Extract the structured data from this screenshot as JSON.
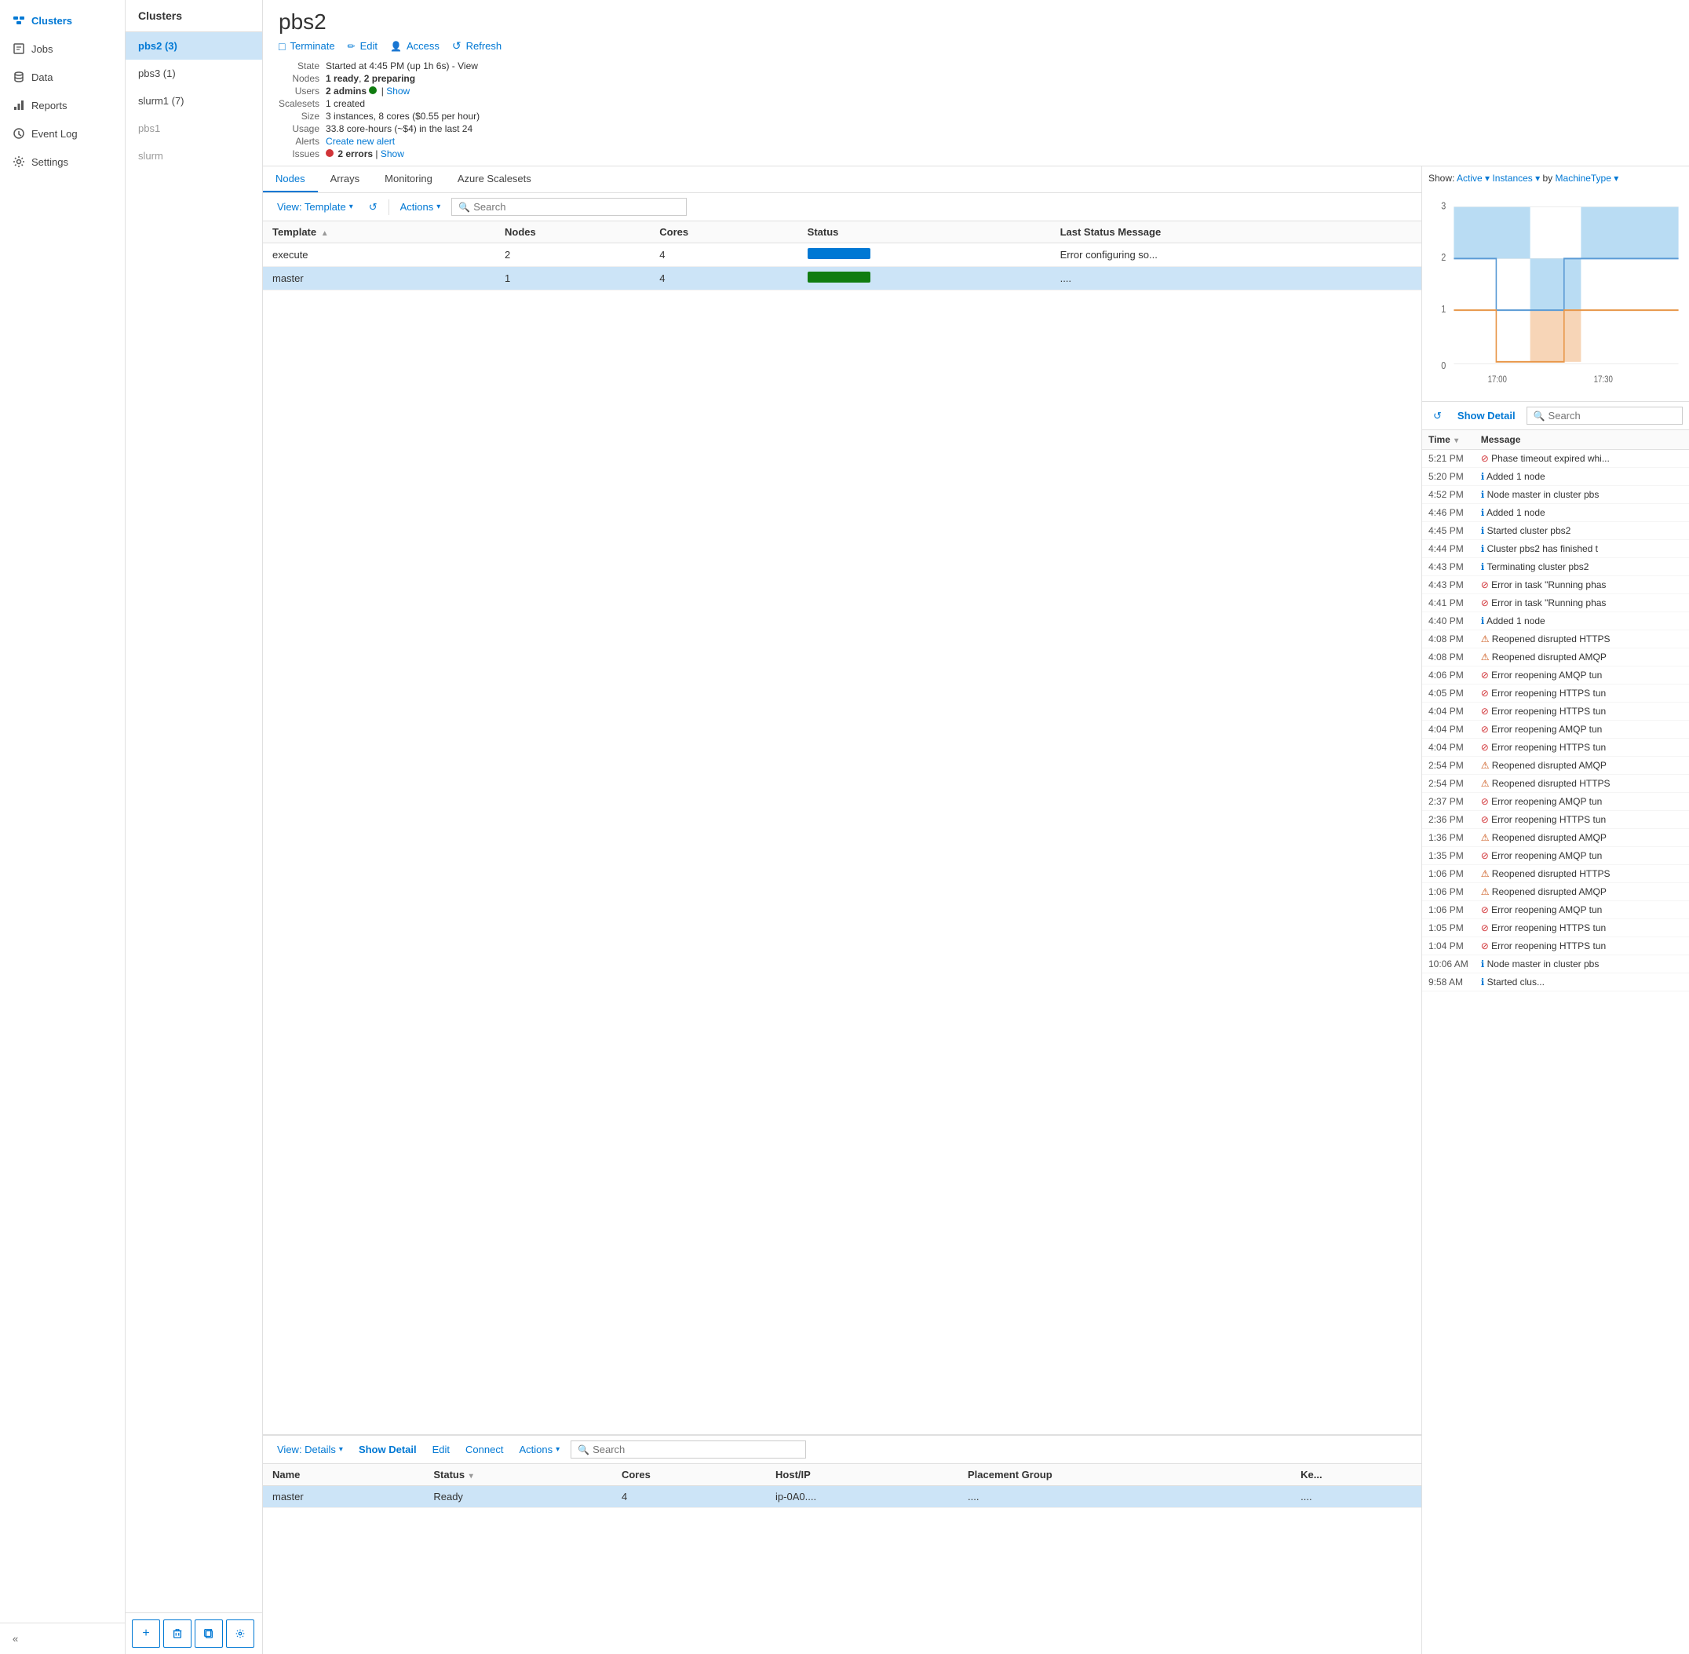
{
  "sidebar": {
    "items": [
      {
        "id": "clusters",
        "label": "Clusters",
        "icon": "cluster-icon",
        "active": true
      },
      {
        "id": "jobs",
        "label": "Jobs",
        "icon": "jobs-icon"
      },
      {
        "id": "data",
        "label": "Data",
        "icon": "data-icon"
      },
      {
        "id": "reports",
        "label": "Reports",
        "icon": "reports-icon"
      },
      {
        "id": "eventlog",
        "label": "Event Log",
        "icon": "eventlog-icon"
      },
      {
        "id": "settings",
        "label": "Settings",
        "icon": "settings-icon"
      }
    ],
    "collapse_label": "«"
  },
  "cluster_list": {
    "header": "Clusters",
    "items": [
      {
        "name": "pbs2 (3)",
        "active": true
      },
      {
        "name": "pbs3 (1)",
        "active": false
      },
      {
        "name": "slurm1 (7)",
        "active": false
      },
      {
        "name": "pbs1",
        "dimmed": true
      },
      {
        "name": "slurm",
        "dimmed": true
      }
    ],
    "footer_buttons": [
      {
        "id": "add",
        "icon": "+",
        "label": "Add"
      },
      {
        "id": "delete",
        "icon": "🗑",
        "label": "Delete"
      },
      {
        "id": "copy",
        "icon": "⧉",
        "label": "Copy"
      },
      {
        "id": "settings",
        "icon": "⚙",
        "label": "Settings"
      }
    ]
  },
  "cluster_detail": {
    "title": "pbs2",
    "actions": [
      {
        "id": "terminate",
        "label": "Terminate",
        "icon": "□"
      },
      {
        "id": "edit",
        "label": "Edit",
        "icon": "✏"
      },
      {
        "id": "access",
        "label": "Access",
        "icon": "👤"
      },
      {
        "id": "refresh",
        "label": "Refresh",
        "icon": "↺"
      }
    ],
    "info": {
      "state_label": "State",
      "state_value": "Started at 4:45 PM (up 1h 6s) - View",
      "nodes_label": "Nodes",
      "nodes_value": "1 ready, 2 preparing",
      "users_label": "Users",
      "users_value": "2 admins",
      "users_show": "Show",
      "scalesets_label": "Scalesets",
      "scalesets_value": "1 created",
      "size_label": "Size",
      "size_value": "3 instances, 8 cores ($0.55 per hour)",
      "usage_label": "Usage",
      "usage_value": "33.8 core-hours (~$4) in the last 24",
      "alerts_label": "Alerts",
      "alerts_create": "Create new alert",
      "issues_label": "Issues",
      "issues_value": "2 errors",
      "issues_show": "Show"
    }
  },
  "nodes_panel": {
    "tabs": [
      "Nodes",
      "Arrays",
      "Monitoring",
      "Azure Scalesets"
    ],
    "active_tab": "Nodes",
    "toolbar": {
      "view_label": "View: Template",
      "refresh_icon": "↺",
      "actions_label": "Actions",
      "search_placeholder": "Search"
    },
    "table": {
      "columns": [
        "Template",
        "Nodes",
        "Cores",
        "Status",
        "Last Status Message"
      ],
      "rows": [
        {
          "template": "execute",
          "nodes": "2",
          "cores": "4",
          "status": "blue",
          "message": "Error configuring so..."
        },
        {
          "template": "master",
          "nodes": "1",
          "cores": "4",
          "status": "green",
          "message": "...."
        }
      ]
    }
  },
  "bottom_panel": {
    "toolbar": {
      "view_label": "View: Details",
      "show_detail": "Show Detail",
      "edit": "Edit",
      "connect": "Connect",
      "actions": "Actions",
      "search_placeholder": "Search"
    },
    "table": {
      "columns": [
        "Name",
        "Status",
        "Cores",
        "Host/IP",
        "Placement Group",
        "Ke..."
      ],
      "rows": [
        {
          "name": "master",
          "status": "Ready",
          "cores": "4",
          "host": "ip-0A0....",
          "placement": "....",
          "key": "...."
        }
      ]
    }
  },
  "right_panel": {
    "show_label": "Show:",
    "active_option": "Active",
    "instances_option": "Instances",
    "by_label": "by",
    "machine_type_option": "MachineType",
    "chart": {
      "y_max": 3,
      "y_labels": [
        "3",
        "2",
        "1",
        "0"
      ],
      "x_labels": [
        "17:00",
        "17:30"
      ],
      "series": [
        {
          "name": "blue",
          "color": "#a8d3f0"
        },
        {
          "name": "orange",
          "color": "#f4c398"
        }
      ]
    },
    "event_log": {
      "show_detail_btn": "Show Detail",
      "refresh_icon": "↺",
      "search_placeholder": "Search",
      "columns": [
        "Time",
        "Message"
      ],
      "events": [
        {
          "time": "5:21 PM",
          "type": "error",
          "msg": "Phase timeout expired whi..."
        },
        {
          "time": "5:20 PM",
          "type": "info",
          "msg": "Added 1 node"
        },
        {
          "time": "4:52 PM",
          "type": "info",
          "msg": "Node master in cluster pbs"
        },
        {
          "time": "4:46 PM",
          "type": "info",
          "msg": "Added 1 node"
        },
        {
          "time": "4:45 PM",
          "type": "info",
          "msg": "Started cluster pbs2"
        },
        {
          "time": "4:44 PM",
          "type": "info",
          "msg": "Cluster pbs2 has finished t"
        },
        {
          "time": "4:43 PM",
          "type": "info",
          "msg": "Terminating cluster pbs2"
        },
        {
          "time": "4:43 PM",
          "type": "error",
          "msg": "Error in task \"Running phas"
        },
        {
          "time": "4:41 PM",
          "type": "error",
          "msg": "Error in task \"Running phas"
        },
        {
          "time": "4:40 PM",
          "type": "info",
          "msg": "Added 1 node"
        },
        {
          "time": "4:08 PM",
          "type": "warn",
          "msg": "Reopened disrupted HTTPS"
        },
        {
          "time": "4:08 PM",
          "type": "warn",
          "msg": "Reopened disrupted AMQP"
        },
        {
          "time": "4:06 PM",
          "type": "error",
          "msg": "Error reopening AMQP tun"
        },
        {
          "time": "4:05 PM",
          "type": "error",
          "msg": "Error reopening HTTPS tun"
        },
        {
          "time": "4:04 PM",
          "type": "error",
          "msg": "Error reopening HTTPS tun"
        },
        {
          "time": "4:04 PM",
          "type": "error",
          "msg": "Error reopening AMQP tun"
        },
        {
          "time": "4:04 PM",
          "type": "error",
          "msg": "Error reopening HTTPS tun"
        },
        {
          "time": "2:54 PM",
          "type": "warn",
          "msg": "Reopened disrupted AMQP"
        },
        {
          "time": "2:54 PM",
          "type": "warn",
          "msg": "Reopened disrupted HTTPS"
        },
        {
          "time": "2:37 PM",
          "type": "error",
          "msg": "Error reopening AMQP tun"
        },
        {
          "time": "2:36 PM",
          "type": "error",
          "msg": "Error reopening HTTPS tun"
        },
        {
          "time": "1:36 PM",
          "type": "warn",
          "msg": "Reopened disrupted AMQP"
        },
        {
          "time": "1:35 PM",
          "type": "error",
          "msg": "Error reopening AMQP tun"
        },
        {
          "time": "1:06 PM",
          "type": "warn",
          "msg": "Reopened disrupted HTTPS"
        },
        {
          "time": "1:06 PM",
          "type": "warn",
          "msg": "Reopened disrupted AMQP"
        },
        {
          "time": "1:06 PM",
          "type": "error",
          "msg": "Error reopening AMQP tun"
        },
        {
          "time": "1:05 PM",
          "type": "error",
          "msg": "Error reopening HTTPS tun"
        },
        {
          "time": "1:04 PM",
          "type": "error",
          "msg": "Error reopening HTTPS tun"
        },
        {
          "time": "10:06 AM",
          "type": "info",
          "msg": "Node master in cluster pbs"
        },
        {
          "time": "9:58 AM",
          "type": "info",
          "msg": "Started clus..."
        }
      ]
    }
  }
}
